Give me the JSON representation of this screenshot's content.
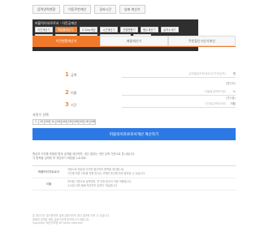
{
  "top_nav": [
    "음력양력변환",
    "이동주번계산",
    "경과시간",
    "날짜 계산기"
  ],
  "panel": {
    "title": "퍼블릭이자로로서 · 이진공계산",
    "chips": [
      {
        "label": "이진계산기",
        "w": "w1",
        "active": false
      },
      {
        "label": "백분율계산기",
        "w": "w2",
        "active": true
      },
      {
        "label": "D-Day계산",
        "w": "w1",
        "active": false
      },
      {
        "label": "시간계산기",
        "w": "w1",
        "active": false
      },
      {
        "label": "진법변환기",
        "w": "w1",
        "active": false
      },
      {
        "label": "평수계산기",
        "w": "w1",
        "active": false
      },
      {
        "label": "글자수세기",
        "w": "w1",
        "active": false
      },
      {
        "label": "나이계산",
        "w": "w1",
        "active": false
      },
      {
        "label": "대출이자계산",
        "w": "w2",
        "active": false
      },
      {
        "label": "적금계산기",
        "w": "w1",
        "active": false
      },
      {
        "label": "퍼블릭이자로로서계산",
        "w": "w3",
        "active": false
      },
      {
        "label": "단위변환",
        "w": "w1",
        "active": false
      }
    ]
  },
  "mode_tabs": [
    {
      "label": "이진변환계산기",
      "active": true
    },
    {
      "label": "배율계산기",
      "active": false
    },
    {
      "label": "쿠폰할인가산식계산",
      "active": false
    }
  ],
  "rows": [
    {
      "num": "1",
      "label": "금액",
      "placeholder": "금액을입력하세요(숫자만입력)",
      "btn": "원"
    },
    {
      "num": "2",
      "label": "이율",
      "placeholder": "이율을입력하세요",
      "btn": "%"
    },
    {
      "num": "3",
      "label": "기간",
      "placeholder": "기간을입력하세요",
      "btn": "개월"
    }
  ],
  "sublines": [
    "(원단위)",
    "(연이율)"
  ],
  "keypad_label": "자릿수 선택",
  "keypad": [
    "1",
    "10",
    "100",
    "1k",
    "10k",
    "100k",
    "1M",
    "10M",
    "100M",
    "1B",
    "10B"
  ],
  "calc_button": "퍼블릭이자로로서계산 계산하기",
  "notes": [
    "원금과 이자를 포함한 합계 금액을 계산하며, 계산 결과는 세전 금액 기준으로 표시됩니다.",
    "각 항목을 입력한 후 계산하기 버튼을 누르세요."
  ],
  "info": [
    {
      "head": "퍼블릭이자로로서",
      "lines": [
        "자동으로 원금과 이자를 합산하여 총액을 계산합니다.",
        "기간에 따른 이자율 적용 방식은 선택한 조건에 따라 달라질 수 있습니다."
      ]
    },
    {
      "head": "이율",
      "lines": [
        "연이율 기준으로 입력하며, 월 단위 환산이 자동 적용됩니다.",
        "소수점 이하 둘째 자리까지 입력이 가능합니다."
      ]
    }
  ],
  "footer": [
    "본 계산기는 참고용이며 실제 금융기관의 계산 결과와 다를 수 있습니다.",
    "정확한 금액은 해당 금융기관에 문의하시기 바랍니다.",
    "Copyright 계산기모음 All rights reserved."
  ]
}
